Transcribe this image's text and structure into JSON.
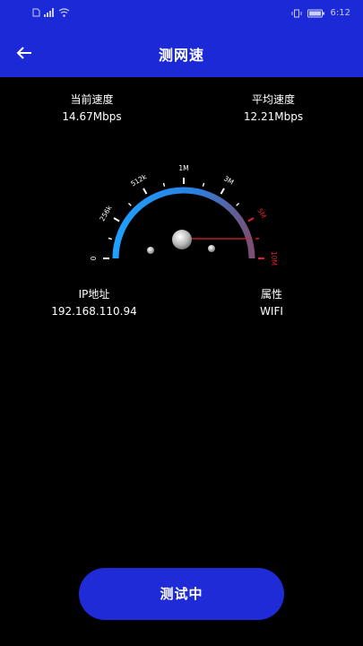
{
  "status_bar": {
    "time": "6:12",
    "icons": [
      "sim-icon",
      "signal-icon",
      "wifi-icon",
      "vibrate-icon",
      "battery-icon"
    ]
  },
  "app_bar": {
    "title": "测网速",
    "back_icon": "arrow-left-icon"
  },
  "speed": {
    "current_label": "当前速度",
    "current_value": "14.67Mbps",
    "average_label": "平均速度",
    "average_value": "12.21Mbps"
  },
  "gauge": {
    "ticks": [
      "0",
      "256k",
      "512k",
      "1M",
      "3M",
      "5M",
      "10M"
    ],
    "needle_value_fraction": 0.98,
    "colors": {
      "arc_start": "#1ea0ff",
      "arc_end": "#7a4f74",
      "needle": "#e0202a",
      "high_tick": "#e0202a"
    }
  },
  "network": {
    "ip_label": "IP地址",
    "ip_value": "192.168.110.94",
    "attr_label": "属性",
    "attr_value": "WIFI"
  },
  "action": {
    "button_label": "测试中"
  },
  "colors": {
    "header": "#1b2ad6",
    "background": "#000000",
    "button": "#1e2bd6"
  }
}
